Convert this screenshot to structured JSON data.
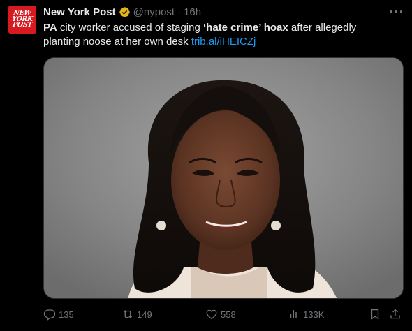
{
  "account": {
    "logo_lines": [
      "NEW",
      "YORK",
      "POST"
    ],
    "name": "New York Post",
    "handle": "@nypost",
    "separator": "·",
    "time": "16h"
  },
  "tweet": {
    "part1": "PA",
    "part2": " city worker accused of staging ",
    "part3": "‘hate crime’ hoax",
    "part4": " after allegedly planting noose at her own desk ",
    "link": "trib.al/iHEICZj"
  },
  "actions": {
    "replies": "135",
    "retweets": "149",
    "likes": "558",
    "views": "133K"
  },
  "colors": {
    "background": "#000000",
    "brand_red": "#d71920",
    "verified_gold": "#e2b719",
    "link": "#1d9bf0",
    "muted": "#71767b"
  }
}
